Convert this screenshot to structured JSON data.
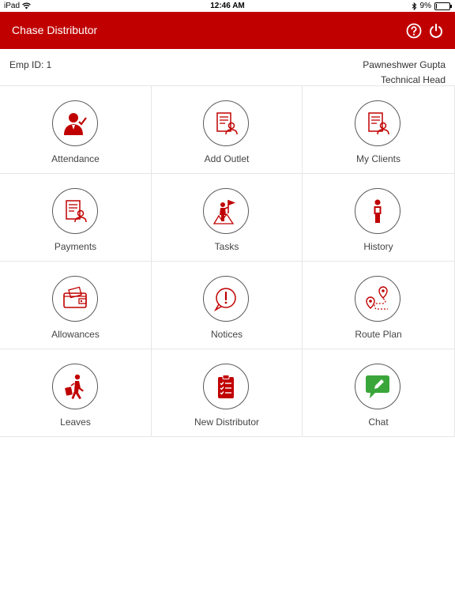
{
  "status_bar": {
    "device": "iPad",
    "time": "12:46 AM",
    "battery": "9%",
    "battery_level": 0.09
  },
  "header": {
    "title": "Chase Distributor",
    "help_icon": "help-icon",
    "power_icon": "power-icon"
  },
  "user": {
    "emp_id": "Emp ID: 1",
    "name": "Pawneshwer Gupta",
    "role": "Technical Head"
  },
  "colors": {
    "brand": "#c00000",
    "chat": "#3aa63a"
  },
  "menu": [
    {
      "label": "Attendance",
      "icon": "attendance-icon"
    },
    {
      "label": "Add Outlet",
      "icon": "add-outlet-icon"
    },
    {
      "label": "My Clients",
      "icon": "my-clients-icon"
    },
    {
      "label": "Payments",
      "icon": "payments-icon"
    },
    {
      "label": "Tasks",
      "icon": "tasks-icon"
    },
    {
      "label": "History",
      "icon": "history-icon"
    },
    {
      "label": "Allowances",
      "icon": "allowances-icon"
    },
    {
      "label": "Notices",
      "icon": "notices-icon"
    },
    {
      "label": "Route Plan",
      "icon": "route-plan-icon"
    },
    {
      "label": "Leaves",
      "icon": "leaves-icon"
    },
    {
      "label": "New Distributor",
      "icon": "new-distributor-icon"
    },
    {
      "label": "Chat",
      "icon": "chat-icon"
    }
  ]
}
